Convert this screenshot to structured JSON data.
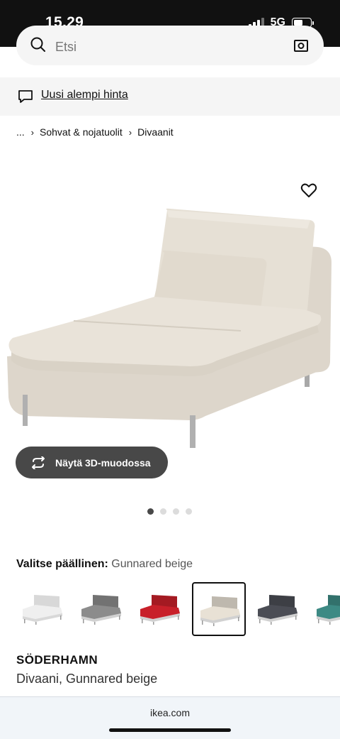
{
  "status_bar": {
    "time": "15.29",
    "network": "5G",
    "battery_level": 0.55
  },
  "search": {
    "placeholder": "Etsi"
  },
  "notice": {
    "text": "Uusi alempi hinta"
  },
  "breadcrumb": {
    "ellipsis": "...",
    "items": [
      "Sohvat & nojatuolit",
      "Divaanit"
    ]
  },
  "gallery": {
    "view_3d_label": "Näytä 3D-muodossa",
    "image_count": 4,
    "active_index": 0
  },
  "cover": {
    "label": "Valitse päällinen:",
    "value": "Gunnared beige",
    "swatch_colors": [
      "#efefef",
      "#8c8c8c",
      "#c8202a",
      "#e8e1d5",
      "#4b4d55",
      "#3d8a84"
    ],
    "selected_index": 3
  },
  "product": {
    "name": "SÖDERHAMN",
    "description": "Divaani, Gunnared beige"
  },
  "browser": {
    "url": "ikea.com"
  },
  "colors": {
    "accent_dark": "#484848",
    "fabric": "#e8e1d5"
  }
}
